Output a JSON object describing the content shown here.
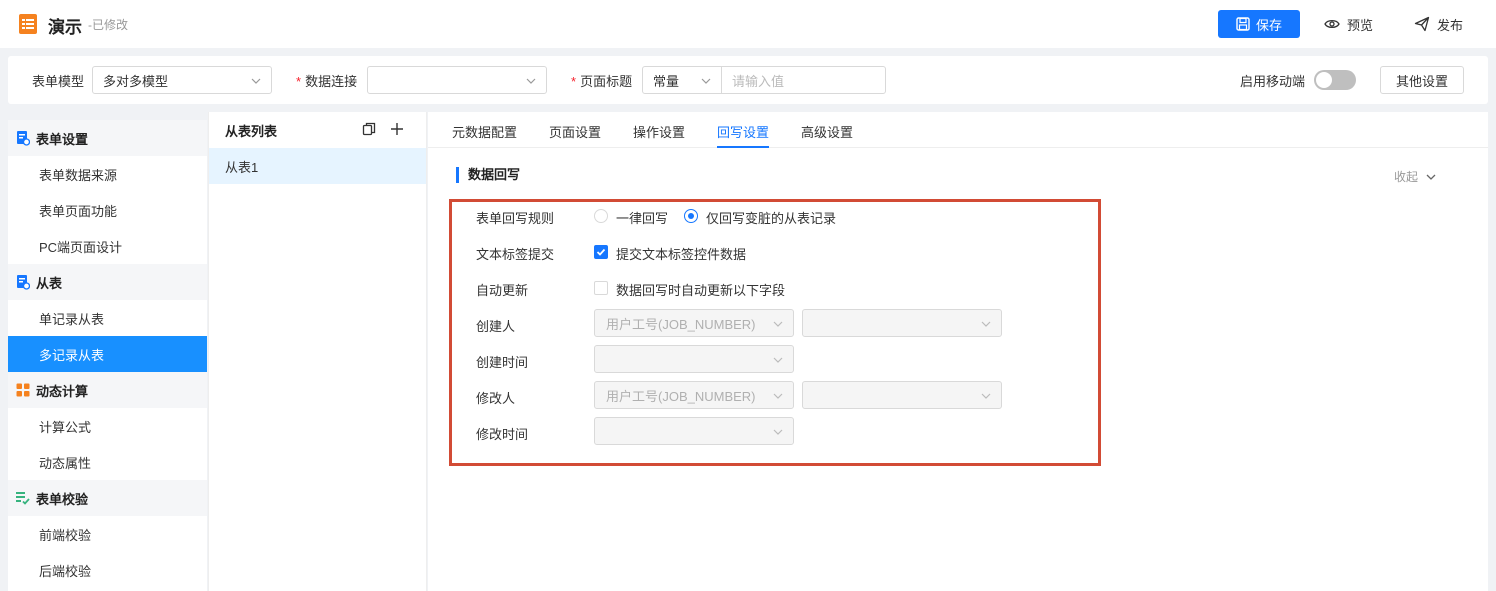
{
  "header": {
    "title": "演示",
    "status": "-已修改",
    "save_label": "保存",
    "preview_label": "预览",
    "publish_label": "发布"
  },
  "toolbar": {
    "form_model_label": "表单模型",
    "form_model_value": "多对多模型",
    "data_conn_label": "数据连接",
    "data_conn_value": "",
    "page_title_label": "页面标题",
    "page_title_type": "常量",
    "page_title_placeholder": "请输入值",
    "mobile_label": "启用移动端",
    "mobile_enabled": false,
    "other_settings_label": "其他设置"
  },
  "sidebar": {
    "groups": [
      {
        "label": "表单设置",
        "icon": "form-settings-icon",
        "items": [
          "表单数据来源",
          "表单页面功能",
          "PC端页面设计"
        ]
      },
      {
        "label": "从表",
        "icon": "subtable-icon",
        "items": [
          "单记录从表",
          "多记录从表"
        ]
      },
      {
        "label": "动态计算",
        "icon": "calc-grid-icon",
        "items": [
          "计算公式",
          "动态属性"
        ]
      },
      {
        "label": "表单校验",
        "icon": "validation-icon",
        "items": [
          "前端校验",
          "后端校验"
        ]
      }
    ],
    "active_item": "多记录从表"
  },
  "subtable_panel": {
    "title": "从表列表",
    "items": [
      "从表1"
    ]
  },
  "tabs": [
    "元数据配置",
    "页面设置",
    "操作设置",
    "回写设置",
    "高级设置"
  ],
  "active_tab": "回写设置",
  "section": {
    "title": "数据回写",
    "collapse_label": "收起",
    "rows": {
      "rule_label": "表单回写规则",
      "rule_option_1": "一律回写",
      "rule_option_2": "仅回写变脏的从表记录",
      "rule_selected": "仅回写变脏的从表记录",
      "text_label_label": "文本标签提交",
      "text_label_option": "提交文本标签控件数据",
      "text_label_checked": true,
      "auto_update_label": "自动更新",
      "auto_update_option": "数据回写时自动更新以下字段",
      "auto_update_checked": false,
      "creator_label": "创建人",
      "creator_field": "用户工号(JOB_NUMBER)",
      "creator_field2": "",
      "create_time_label": "创建时间",
      "create_time_field": "",
      "modifier_label": "修改人",
      "modifier_field": "用户工号(JOB_NUMBER)",
      "modifier_field2": "",
      "modify_time_label": "修改时间",
      "modify_time_field": ""
    }
  },
  "colors": {
    "accent": "#1677ff",
    "highlight_border": "#d24b35",
    "active_item_bg": "#1890ff"
  }
}
